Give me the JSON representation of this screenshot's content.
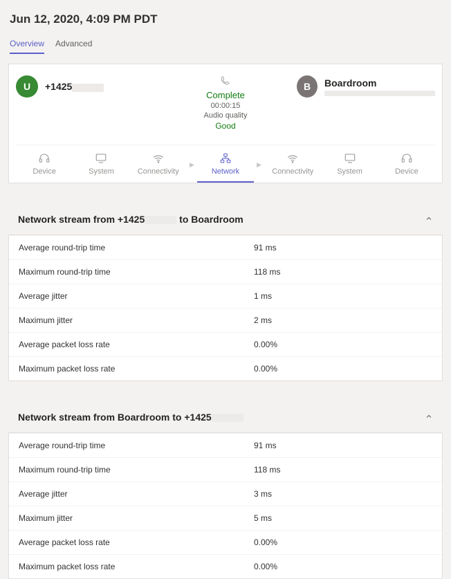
{
  "title": "Jun 12, 2020, 4:09 PM PDT",
  "tabs": {
    "overview": "Overview",
    "advanced": "Advanced"
  },
  "call": {
    "callerAvatar": "U",
    "callerName": "+1425",
    "status": "Complete",
    "duration": "00:00:15",
    "aqLabel": "Audio quality",
    "aqValue": "Good",
    "calleeAvatar": "B",
    "calleeName": "Boardroom"
  },
  "flow": {
    "device": "Device",
    "system": "System",
    "connectivity": "Connectivity",
    "network": "Network"
  },
  "sections": [
    {
      "title": "Network stream from +1425▯▯▯▯ to Boardroom",
      "rows": [
        {
          "k": "Average round-trip time",
          "v": "91 ms"
        },
        {
          "k": "Maximum round-trip time",
          "v": "118 ms"
        },
        {
          "k": "Average jitter",
          "v": "1 ms"
        },
        {
          "k": "Maximum jitter",
          "v": "2 ms"
        },
        {
          "k": "Average packet loss rate",
          "v": "0.00%"
        },
        {
          "k": "Maximum packet loss rate",
          "v": "0.00%"
        }
      ]
    },
    {
      "title": "Network stream from Boardroom to +1425▯▯▯▯",
      "rows": [
        {
          "k": "Average round-trip time",
          "v": "91 ms"
        },
        {
          "k": "Maximum round-trip time",
          "v": "118 ms"
        },
        {
          "k": "Average jitter",
          "v": "3 ms"
        },
        {
          "k": "Maximum jitter",
          "v": "5 ms"
        },
        {
          "k": "Average packet loss rate",
          "v": "0.00%"
        },
        {
          "k": "Maximum packet loss rate",
          "v": "0.00%"
        }
      ]
    }
  ]
}
